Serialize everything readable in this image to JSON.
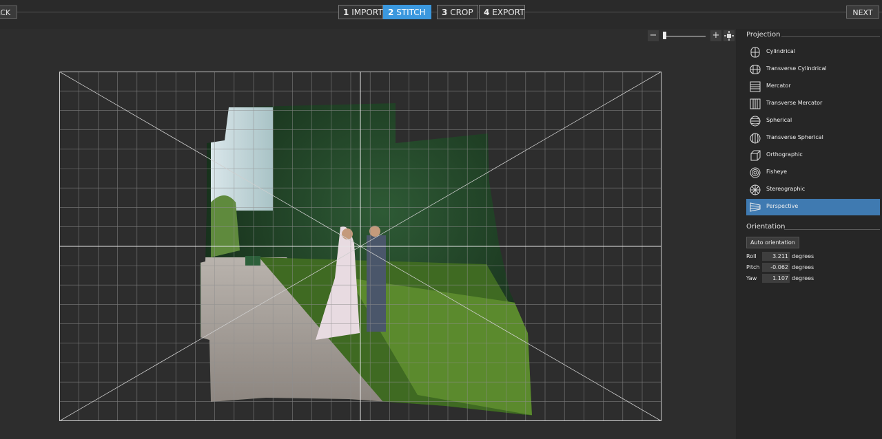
{
  "topbar": {
    "back_label": "ACK",
    "next_label": "NEXT",
    "steps": [
      {
        "num": "1",
        "label": "IMPORT"
      },
      {
        "num": "2",
        "label": "STITCH",
        "active": true
      },
      {
        "num": "3",
        "label": "CROP"
      },
      {
        "num": "4",
        "label": "EXPORT"
      }
    ]
  },
  "zoom": {
    "minus": "−",
    "plus": "+",
    "fit_icon": "fit-icon"
  },
  "projection": {
    "title": "Projection",
    "items": [
      {
        "label": "Cylindrical",
        "icon": "cylindrical-icon"
      },
      {
        "label": "Transverse Cylindrical",
        "icon": "transverse-cylindrical-icon"
      },
      {
        "label": "Mercator",
        "icon": "mercator-icon"
      },
      {
        "label": "Transverse Mercator",
        "icon": "transverse-mercator-icon"
      },
      {
        "label": "Spherical",
        "icon": "spherical-icon"
      },
      {
        "label": "Transverse Spherical",
        "icon": "transverse-spherical-icon"
      },
      {
        "label": "Orthographic",
        "icon": "orthographic-icon"
      },
      {
        "label": "Fisheye",
        "icon": "fisheye-icon"
      },
      {
        "label": "Stereographic",
        "icon": "stereographic-icon"
      },
      {
        "label": "Perspective",
        "icon": "perspective-icon",
        "active": true
      }
    ]
  },
  "orientation": {
    "title": "Orientation",
    "auto_label": "Auto orientation",
    "roll": {
      "label": "Roll",
      "value": "3.211",
      "unit": "degrees"
    },
    "pitch": {
      "label": "Pitch",
      "value": "-0.062",
      "unit": "degrees"
    },
    "yaw": {
      "label": "Yaw",
      "value": "1.107",
      "unit": "degrees"
    }
  },
  "colors": {
    "accent": "#3b98de",
    "selected": "#3f7ab1",
    "panel": "#262626"
  }
}
